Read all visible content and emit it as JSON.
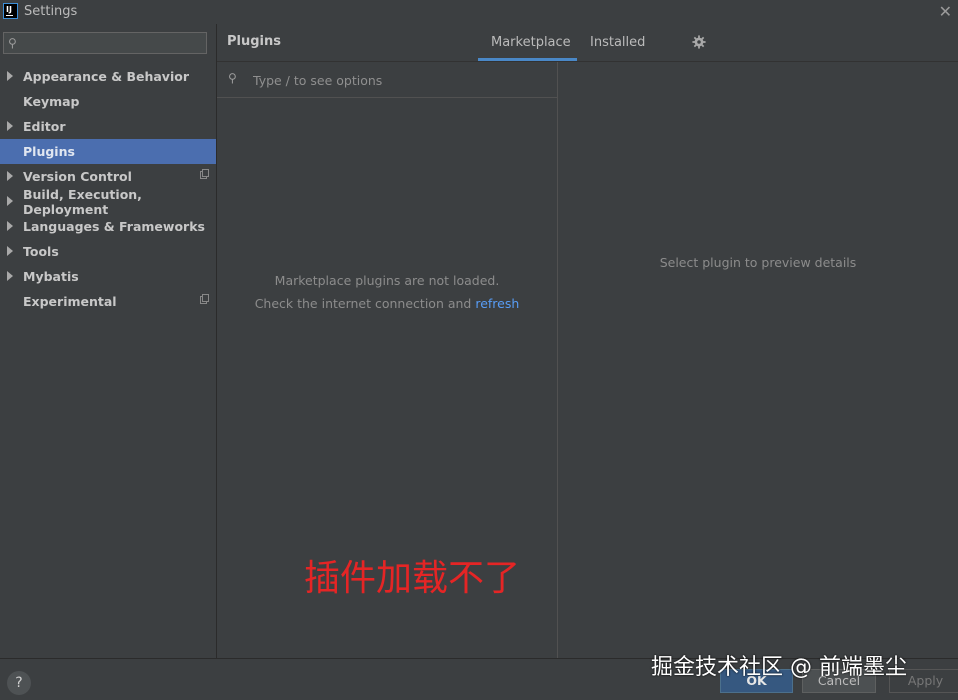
{
  "window": {
    "logo_text": "IJ",
    "title": "Settings",
    "close_glyph": "✕"
  },
  "sidebar": {
    "search_placeholder": "",
    "items": [
      {
        "label": "Appearance & Behavior",
        "expandable": true,
        "active": false,
        "icon": "chevron-right-icon"
      },
      {
        "label": "Keymap",
        "expandable": false,
        "active": false
      },
      {
        "label": "Editor",
        "expandable": true,
        "active": false,
        "icon": "chevron-right-icon"
      },
      {
        "label": "Plugins",
        "expandable": false,
        "active": true
      },
      {
        "label": "Version Control",
        "expandable": true,
        "active": false,
        "icon": "chevron-right-icon",
        "badge_icon": "copy-icon"
      },
      {
        "label": "Build, Execution, Deployment",
        "expandable": true,
        "active": false,
        "icon": "chevron-right-icon"
      },
      {
        "label": "Languages & Frameworks",
        "expandable": true,
        "active": false,
        "icon": "chevron-right-icon"
      },
      {
        "label": "Tools",
        "expandable": true,
        "active": false,
        "icon": "chevron-right-icon"
      },
      {
        "label": "Mybatis",
        "expandable": true,
        "active": false,
        "icon": "chevron-right-icon"
      },
      {
        "label": "Experimental",
        "expandable": false,
        "active": false,
        "badge_icon": "copy-icon"
      }
    ]
  },
  "header": {
    "title": "Plugins",
    "tabs": [
      {
        "label": "Marketplace",
        "selected": true
      },
      {
        "label": "Installed",
        "selected": false
      }
    ],
    "settings_icon": "gear-icon"
  },
  "plugin_list": {
    "search_placeholder": "Type / to see options",
    "empty_line1": "Marketplace plugins are not loaded.",
    "empty_line2_prefix": "Check the internet connection and ",
    "refresh_label": "refresh"
  },
  "details": {
    "placeholder": "Select plugin to preview details"
  },
  "annotation": {
    "text": "插件加载不了",
    "color": "#e52525"
  },
  "footer": {
    "help_label": "?",
    "ok_label": "OK",
    "cancel_label": "Cancel",
    "apply_label": "Apply"
  },
  "watermark": {
    "text": "掘金技术社区 @ 前端墨尘"
  },
  "colors": {
    "background": "#3c3f41",
    "selection": "#4b6eaf",
    "link": "#589df6",
    "tab_underline": "#4a88c7"
  }
}
